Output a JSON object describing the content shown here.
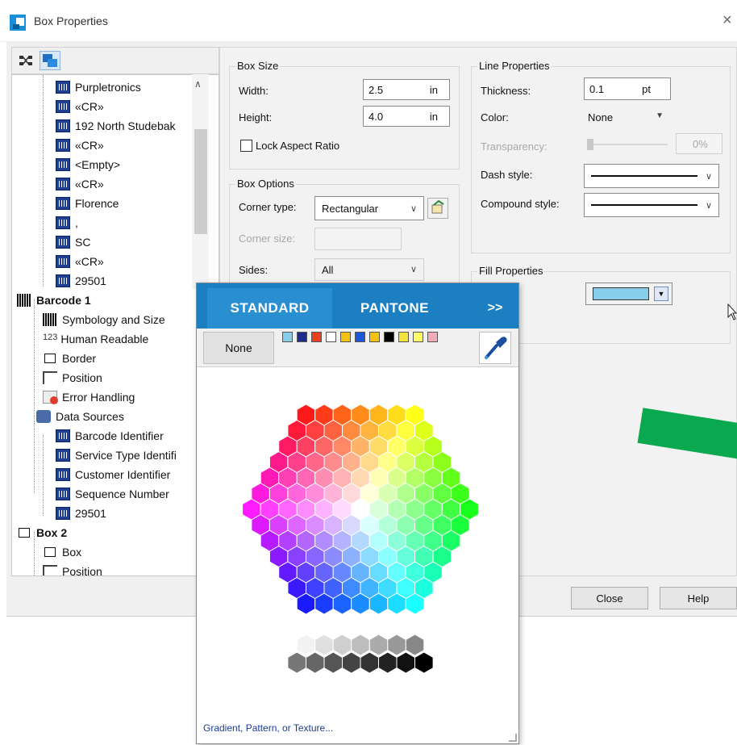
{
  "window": {
    "title": "Box Properties",
    "close_glyph": "×"
  },
  "tree": {
    "toolbar_icons": [
      "tree-view-icon",
      "layers-icon"
    ],
    "items": [
      {
        "label": "Purpletronics",
        "icon": "field-icon"
      },
      {
        "label": "«CR»",
        "icon": "field-icon"
      },
      {
        "label": "192 North Studebak",
        "icon": "field-icon"
      },
      {
        "label": "«CR»",
        "icon": "field-icon"
      },
      {
        "label": "<Empty>",
        "icon": "field-icon"
      },
      {
        "label": "«CR»",
        "icon": "field-icon"
      },
      {
        "label": "Florence",
        "icon": "field-icon"
      },
      {
        "label": ",",
        "icon": "field-icon"
      },
      {
        "label": "SC",
        "icon": "field-icon"
      },
      {
        "label": "«CR»",
        "icon": "field-icon"
      },
      {
        "label": "29501",
        "icon": "field-icon"
      },
      {
        "label": "Barcode 1",
        "icon": "barcode-icon"
      },
      {
        "label": "Symbology and Size",
        "icon": "barcode-icon"
      },
      {
        "label": "Human Readable",
        "icon": "number-icon",
        "icon_text": "123"
      },
      {
        "label": "Border",
        "icon": "border-icon"
      },
      {
        "label": "Position",
        "icon": "position-icon"
      },
      {
        "label": "Error Handling",
        "icon": "error-icon"
      },
      {
        "label": "Data Sources",
        "icon": "data-sources-icon"
      },
      {
        "label": "Barcode Identifier",
        "icon": "field-icon"
      },
      {
        "label": "Service Type Identifi",
        "icon": "field-icon"
      },
      {
        "label": "Customer Identifier",
        "icon": "field-icon"
      },
      {
        "label": "Sequence Number",
        "icon": "field-icon"
      },
      {
        "label": "29501",
        "icon": "field-icon"
      },
      {
        "label": "Box 2",
        "icon": "box-icon"
      },
      {
        "label": "Box",
        "icon": "box-icon"
      },
      {
        "label": "Position",
        "icon": "position-icon"
      }
    ]
  },
  "box_size": {
    "title": "Box Size",
    "width_label": "Width:",
    "width_value": "2.5",
    "width_unit": "in",
    "height_label": "Height:",
    "height_value": "4.0",
    "height_unit": "in",
    "lock_label": "Lock Aspect Ratio",
    "lock_checked": false
  },
  "box_options": {
    "title": "Box Options",
    "corner_type_label": "Corner type:",
    "corner_type_value": "Rectangular",
    "corner_size_label": "Corner size:",
    "corner_size_value": "",
    "sides_label": "Sides:",
    "sides_value": "All"
  },
  "line_properties": {
    "title": "Line Properties",
    "thickness_label": "Thickness:",
    "thickness_value": "0.1",
    "thickness_unit": "pt",
    "color_label": "Color:",
    "color_value": "None",
    "transparency_label": "Transparency:",
    "transparency_value": "0%",
    "dash_label": "Dash style:",
    "compound_label": "Compound style:"
  },
  "fill_properties": {
    "title": "Fill Properties",
    "color": "#87ceeb"
  },
  "footer": {
    "close_label": "Close",
    "help_label": "Help"
  },
  "color_popup": {
    "tab_standard": "STANDARD",
    "tab_pantone": "PANTONE",
    "tab_more": ">>",
    "none_label": "None",
    "recent_colors": [
      "#87ceeb",
      "#1f2c8f",
      "#e8401c",
      "#ffffff",
      "#f4c20d",
      "#1a56d8",
      "#f4c20d",
      "#000000",
      "#f4e23d",
      "#ffff66",
      "#f4aab8"
    ],
    "gradient_link": "Gradient, Pattern, or Texture..."
  },
  "accent": {
    "tab_bar": "#1b7fc1",
    "annotation_arrow": "#0aa84f"
  }
}
